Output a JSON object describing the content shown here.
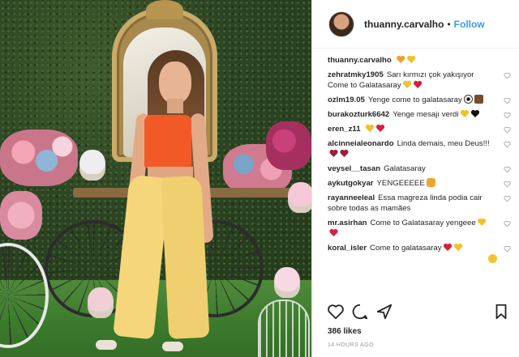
{
  "post": {
    "username": "thuanny.carvalho",
    "separator": "•",
    "follow_label": "Follow",
    "likes": "386 likes",
    "time": "14 HOURS AGO"
  },
  "comments": [
    {
      "user": "thuanny.carvalho",
      "text": "",
      "emoji": [
        "heart-orange",
        "heart-yellow"
      ]
    },
    {
      "user": "zehratmky1905",
      "text": "Sarı kırmızı çok yakışıyor Come to Galatasaray",
      "emoji": [
        "heart-yellow",
        "heart-red"
      ]
    },
    {
      "user": "ozlm19.05",
      "text": "Yenge come to galatasaray",
      "emoji": [
        "ball",
        "tea"
      ]
    },
    {
      "user": "burakozturk6642",
      "text": "Yenge mesajı verdi",
      "emoji": [
        "heart-yellow",
        "heart-black"
      ]
    },
    {
      "user": "eren_z11",
      "text": "",
      "emoji": [
        "heart-yellow",
        "heart-red"
      ]
    },
    {
      "user": "alcinneialeonardo",
      "text": "Linda demais, meu Deus!!!",
      "emoji": [
        "heart-maroon",
        "heart-maroon"
      ]
    },
    {
      "user": "veysel__tasan",
      "text": "Galatasaray",
      "emoji": []
    },
    {
      "user": "aykutgokyar",
      "text": "YENGEEEEE",
      "emoji": [
        "cat"
      ]
    },
    {
      "user": "rayanneeleal",
      "text": "Essa magreza linda podia cair sobre todas as mamães",
      "emoji": [
        "face"
      ]
    },
    {
      "user": "mr.asirhan",
      "text": "Come to Galatasaray yengeee",
      "emoji": [
        "heart-yellow",
        "heart-red"
      ]
    },
    {
      "user": "koral_isler",
      "text": "Come to galatasaray",
      "emoji": [
        "heart-red",
        "heart-yellow"
      ]
    }
  ],
  "icons": {
    "like": "heart-outline-icon",
    "comment": "comment-bubble-icon",
    "share": "share-arrow-icon",
    "save": "bookmark-icon"
  },
  "colors": {
    "follow": "#3897f0",
    "top": "#f15a27",
    "pants": "#f5d67a"
  }
}
